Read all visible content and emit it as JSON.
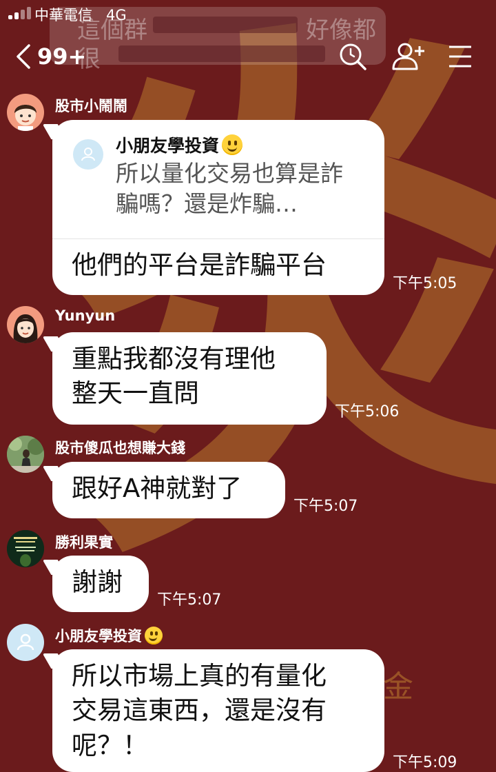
{
  "status_bar": {
    "carrier": "中華電信",
    "network": "4G"
  },
  "ghost_notification": {
    "line1": "這個群",
    "line1_end": "好像都",
    "line2": "很"
  },
  "header": {
    "unread_count": "99+"
  },
  "colors": {
    "background": "#6b1b1c",
    "bubble": "#ffffff",
    "background_glyph": "#b8782e"
  },
  "background": {
    "glyph": "炎",
    "small_glyph": "金"
  },
  "messages": [
    {
      "sender": "股市小鬧鬧",
      "avatar": "cartoon-boy",
      "reply": {
        "name": "小朋友學投資",
        "text": "所以量化交易也算是詐騙嗎？還是炸騙…"
      },
      "text": "他們的平台是詐騙平台",
      "time": "下午5:05"
    },
    {
      "sender": "Yunyun",
      "avatar": "cartoon-girl",
      "text": "重點我都沒有理他\n整天一直問",
      "time": "下午5:06"
    },
    {
      "sender": "股市傻瓜也想賺大錢",
      "avatar": "photo-green",
      "text": "跟好A神就對了",
      "time": "下午5:07"
    },
    {
      "sender": "勝利果實",
      "avatar": "photo-dark",
      "text": "謝謝",
      "time": "下午5:07"
    },
    {
      "sender": "小朋友學投資",
      "avatar": "default-user",
      "text": "所以市場上真的有量化\n交易這東西，還是沒有\n呢？！",
      "time": "下午5:09"
    }
  ]
}
